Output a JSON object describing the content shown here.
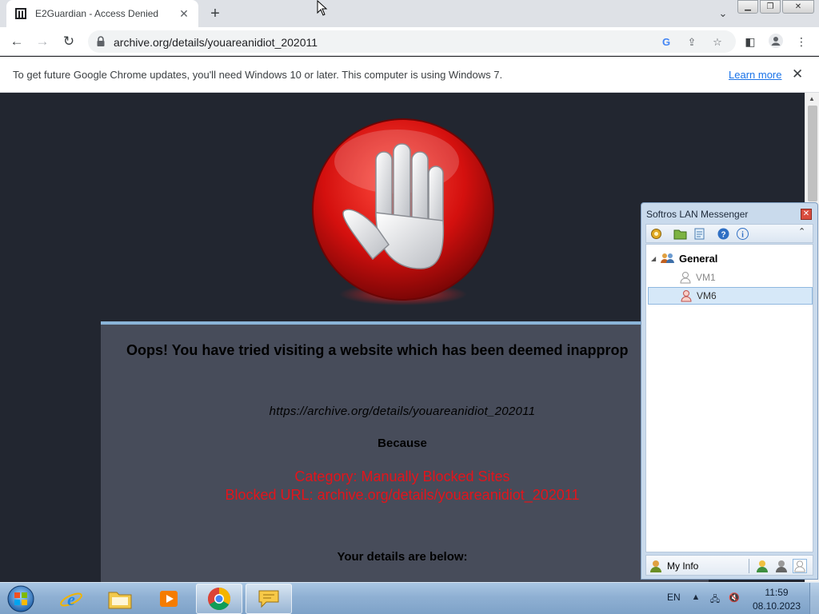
{
  "browser": {
    "tab_title": "E2Guardian - Access Denied",
    "url": "archive.org/details/youareanidiot_202011",
    "colors": {
      "link": "#1a73e8",
      "tab_bg": "#dee1e6"
    }
  },
  "infobar": {
    "message": "To get future Google Chrome updates, you'll need Windows 10 or later. This computer is using Windows 7.",
    "learn_more": "Learn more"
  },
  "page": {
    "heading": "Oops! You have tried visiting a website which has been deemed inapprop",
    "blocked_url": "https://archive.org/details/youareanidiot_202011",
    "because": "Because",
    "category": "Category: Manually Blocked Sites",
    "blocked_line": "Blocked URL: archive.org/details/youareanidiot_202011",
    "details_heading": "Your details are below:",
    "colors": {
      "background": "#222630",
      "panel": "#474c5a",
      "reason_text": "#e3141b"
    }
  },
  "messenger": {
    "title": "Softros LAN Messenger",
    "group": "General",
    "users": [
      "VM1",
      "VM6"
    ],
    "selected_user": "VM6",
    "my_info": "My Info"
  },
  "taskbar": {
    "apps": [
      "internet-explorer",
      "windows-explorer",
      "media-player",
      "google-chrome",
      "softros-lan-messenger"
    ],
    "language": "EN",
    "time": "11:59",
    "date": "08.10.2023"
  }
}
